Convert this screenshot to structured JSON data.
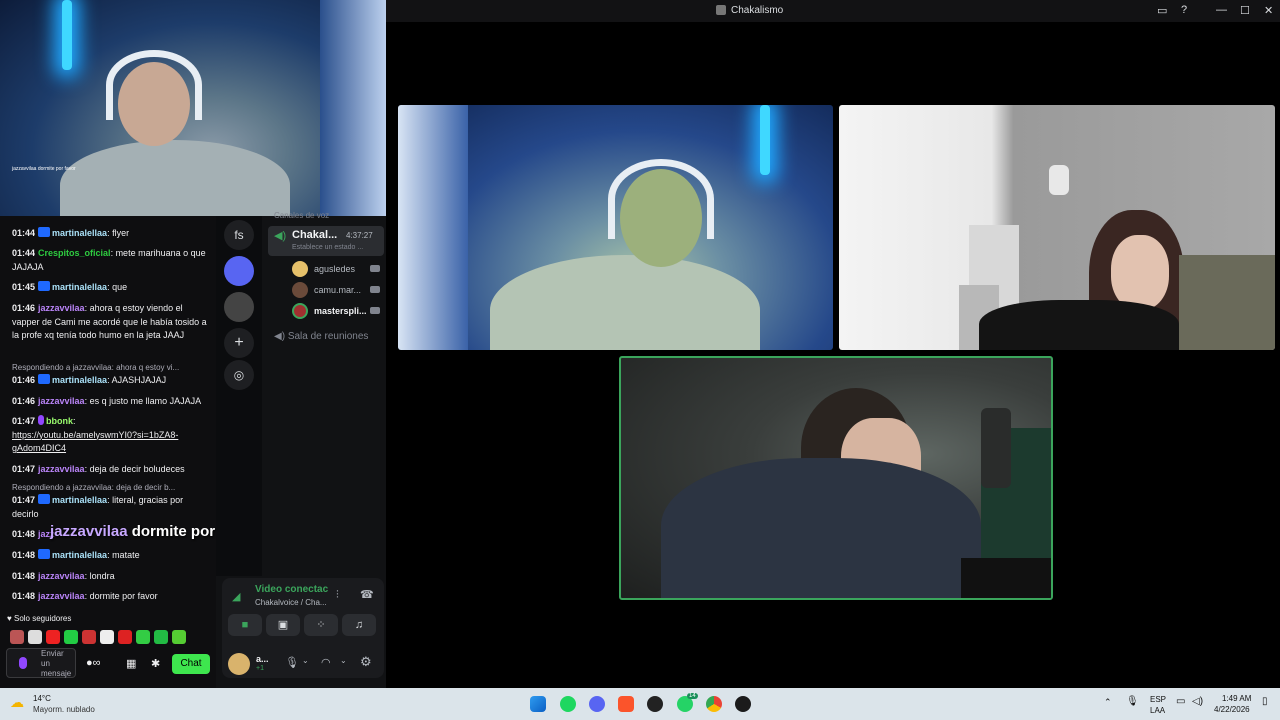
{
  "window": {
    "title": "Chakalismo"
  },
  "stream_overlay": {
    "caption": "jazzavvilaa dormite por favor"
  },
  "chat": {
    "messages": [
      {
        "time": "01:44",
        "user": "martinalellaa",
        "text": ": flyer"
      },
      {
        "time": "01:44",
        "user": "Crespitos_oficial",
        "text": ": mete marihuana o que JAJAJA"
      },
      {
        "time": "01:45",
        "user": "martinalellaa",
        "text": ": que"
      },
      {
        "time": "01:46",
        "user": "jazzavvilaa",
        "text": ": ahora q estoy viendo el vapper de Cami me acordé que le había tosido a la profe xq tenía todo humo en la jeta JAAJ"
      },
      {
        "reply": "Respondiendo a jazzavvilaa: ahora q estoy vi..."
      },
      {
        "time": "01:46",
        "user": "martinalellaa",
        "text": ": AJASHJAJAJ"
      },
      {
        "time": "01:46",
        "user": "jazzavvilaa",
        "text": ": es q justo me llamo JAJAJA"
      },
      {
        "time": "01:47",
        "user": "bbonk",
        "text": ":",
        "link": "https://youtu.be/amelyswmYI0?si=1bZA8-gAdom4DIC4"
      },
      {
        "time": "01:47",
        "user": "jazzavvilaa",
        "text": ": deja de decir boludeces"
      },
      {
        "reply": "Respondiendo a jazzavvilaa: deja de decir b..."
      },
      {
        "time": "01:47",
        "user": "martinalellaa",
        "text": ": literal, gracias por decirlo"
      },
      {
        "time": "01:48",
        "user": "jazz",
        "text": ""
      },
      {
        "time": "01:48",
        "user": "martinalellaa",
        "text": ": matate"
      },
      {
        "time": "01:48",
        "user": "jazzavvilaa",
        "text": ": londra"
      },
      {
        "time": "01:48",
        "user": "jazzavvilaa",
        "text": ": dormite por favor"
      }
    ],
    "followers_only": "Solo seguidores",
    "input_placeholder": "Enviar un mensaje",
    "chat_button": "Chat"
  },
  "overlay_caption": {
    "user": "jazzavvilaa",
    "text": "dormite por favor"
  },
  "discord": {
    "voice_channels_header": "Canales de voz",
    "server_initials": "fs",
    "channel": {
      "name": "Chakal...",
      "status": "Establece un estado ...",
      "timer": "4:37:27"
    },
    "members": [
      "agusledes",
      "camu.mar...",
      "masterspli..."
    ],
    "meeting_room": "Sala de reuniones",
    "voice_status": {
      "title": "Video conectac",
      "subtitle": "Chakalvoice / Cha..."
    },
    "user_short": "a...",
    "user_sub": "+1"
  },
  "taskbar": {
    "weather_temp": "14°C",
    "weather_desc": "Mayorm. nublado",
    "lang": "ESP",
    "lang_sub": "LAA",
    "time": "1:49 AM",
    "date": "4/22/2026",
    "discord_badge": "",
    "whatsapp_badge": "14"
  }
}
